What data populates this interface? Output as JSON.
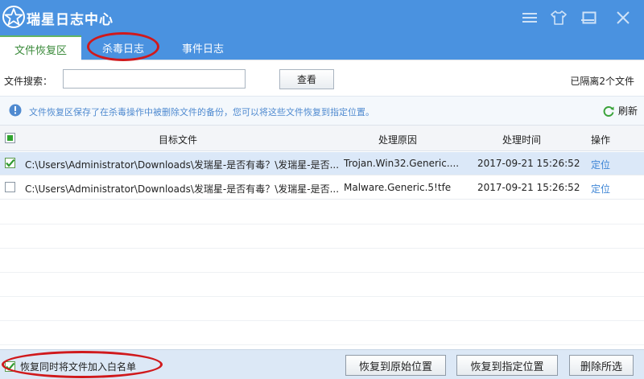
{
  "app": {
    "title": "瑞星日志中心",
    "accent": "#4a92e0"
  },
  "window_controls": {
    "menu": "menu-icon",
    "skin": "shirt-icon",
    "minimize": "minimize-icon",
    "maximize": "maximize-icon",
    "close": "close-icon"
  },
  "tabs": [
    {
      "label": "文件恢复区",
      "active": true
    },
    {
      "label": "杀毒日志",
      "active": false
    },
    {
      "label": "事件日志",
      "active": false
    }
  ],
  "search": {
    "label": "文件搜索：",
    "value": "",
    "button": "查看"
  },
  "isolated_count": "已隔离2个文件",
  "info": {
    "text": "文件恢复区保存了在杀毒操作中被删除文件的备份，您可以将这些文件恢复到指定位置。",
    "refresh": "刷新"
  },
  "table": {
    "headers": {
      "file": "目标文件",
      "reason": "处理原因",
      "time": "处理时间",
      "action": "操作"
    },
    "rows": [
      {
        "checked": true,
        "file": "C:\\Users\\Administrator\\Downloads\\发瑞星-是否有毒？\\发瑞星-是否...",
        "reason": "Trojan.Win32.Generic....",
        "time": "2017-09-21 15:26:52",
        "action": "定位"
      },
      {
        "checked": false,
        "file": "C:\\Users\\Administrator\\Downloads\\发瑞星-是否有毒？\\发瑞星-是否...",
        "reason": "Malware.Generic.5!tfe",
        "time": "2017-09-21 15:26:52",
        "action": "定位"
      }
    ]
  },
  "footer": {
    "whitelist_label": "恢复同时将文件加入白名单",
    "whitelist_checked": true,
    "restore_original": "恢复到原始位置",
    "restore_specified": "恢复到指定位置",
    "delete_selected": "删除所选"
  }
}
